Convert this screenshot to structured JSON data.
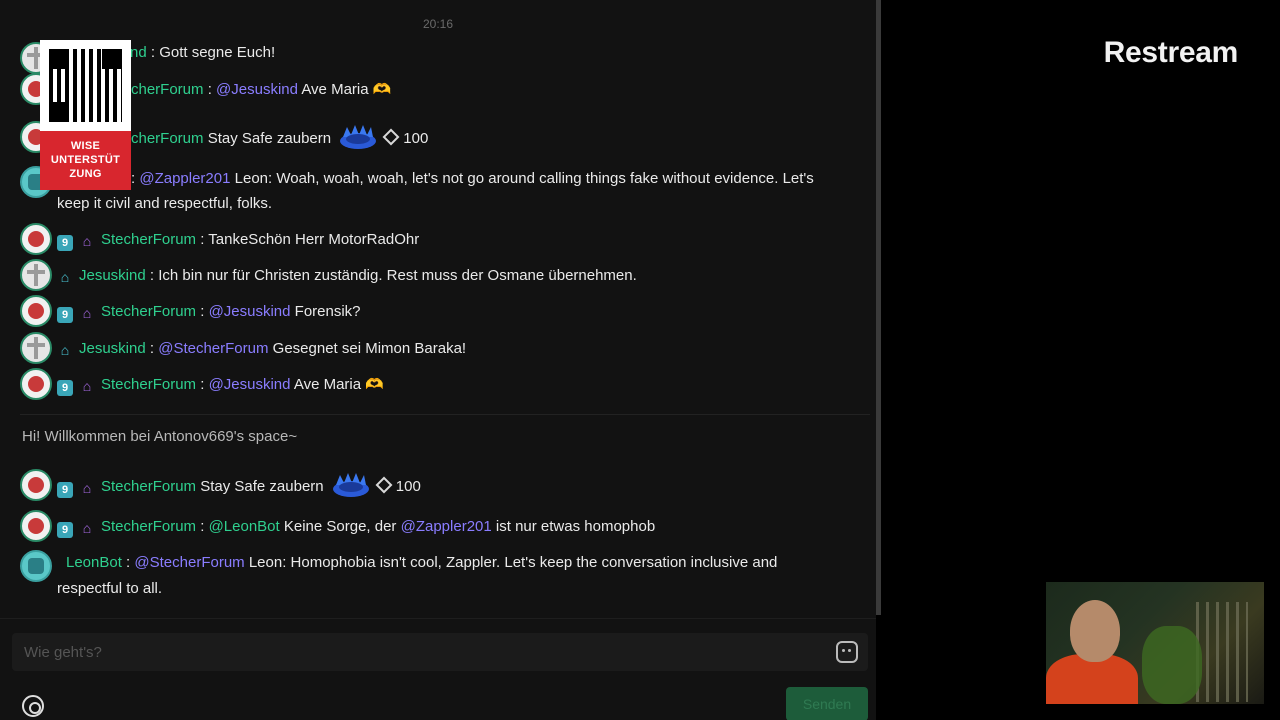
{
  "brand": "Restream",
  "timestamp": "20:16",
  "qr": {
    "label": "WISE UNTERSTÜT ZUNG"
  },
  "messages": [
    {
      "user": "nd",
      "sep": " : ",
      "text": "Gott segne Euch!"
    },
    {
      "user": "cherForum",
      "sep": " : ",
      "mention": "@Jesuskind",
      "text": " Ave Maria ",
      "emoji": "🫶"
    },
    {
      "user": "cherForum",
      "text": " Stay Safe zaubern ",
      "amount": "100"
    },
    {
      "sep": ": ",
      "mention": "@Zappler201",
      "text": " Leon: Woah, woah, woah, let's not go around calling things fake without evidence. Let's",
      "text2": "keep it civil and respectful, folks."
    },
    {
      "level": "9",
      "user": "StecherForum",
      "sep": " : ",
      "text": "TankeSchön Herr MotorRadOhr"
    },
    {
      "user": "Jesuskind",
      "sep": " : ",
      "text": "Ich bin nur für Christen zuständig. Rest muss der Osmane übernehmen."
    },
    {
      "level": "9",
      "user": "StecherForum",
      "sep": " : ",
      "mention": "@Jesuskind",
      "text": " Forensik?"
    },
    {
      "user": "Jesuskind",
      "sep": " : ",
      "mention": "@StecherForum",
      "text": " Gesegnet sei Mimon Baraka!"
    },
    {
      "level": "9",
      "user": "StecherForum",
      "sep": " : ",
      "mention": "@Jesuskind",
      "text": " Ave Maria ",
      "emoji": "🫶"
    }
  ],
  "welcome": "Hi! Willkommen bei Antonov669's space~",
  "messages2": [
    {
      "level": "9",
      "user": "StecherForum",
      "text": " Stay Safe zaubern ",
      "amount": "100"
    },
    {
      "level": "9",
      "user": "StecherForum",
      "sep": " : ",
      "mention": "@LeonBot",
      "text": " Keine Sorge, der ",
      "mention2": "@Zappler201",
      "text_end": " ist nur etwas homophob"
    },
    {
      "user": "LeonBot",
      "sep": " : ",
      "mention": "@StecherForum",
      "text": " Leon: Homophobia isn't cool, Zappler. Let's keep the conversation inclusive and",
      "text2": "respectful to all."
    }
  ],
  "input": {
    "placeholder": "Wie geht's?"
  },
  "send_label": "Senden",
  "icons": {
    "settings": "settings-icon",
    "emoji": "emoji-icon",
    "house": "house-badge-icon",
    "gem": "gem-icon",
    "gift": "gift-icon"
  }
}
